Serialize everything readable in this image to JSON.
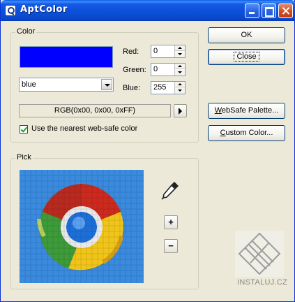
{
  "window": {
    "title": "AptColor"
  },
  "color_group": {
    "label": "Color",
    "swatch_color": "#0000ff",
    "name_select": {
      "value": "blue"
    },
    "red": {
      "label": "Red:",
      "value": "0"
    },
    "green": {
      "label": "Green:",
      "value": "0"
    },
    "blue": {
      "label": "Blue:",
      "value": "255"
    },
    "rgb_text": "RGB(0x00, 0x00, 0xFF)",
    "websafe_checkbox": {
      "label": "Use the nearest web-safe color",
      "checked": true
    }
  },
  "buttons": {
    "ok": "OK",
    "close": "Close",
    "websafe_palette": "WebSafe Palette...",
    "custom_color": "Custom Color..."
  },
  "pick_group": {
    "label": "Pick",
    "zoom_in": "+",
    "zoom_out": "−",
    "eyedropper_icon": "eyedropper-icon",
    "preview_icon": "chrome-logo-pixelated"
  },
  "watermark": {
    "text": "INSTALUJ.CZ"
  },
  "colors": {
    "titlebar": "#0a4fd8",
    "window_bg": "#ece9d8",
    "pick_bg": "#3b8cdc"
  }
}
